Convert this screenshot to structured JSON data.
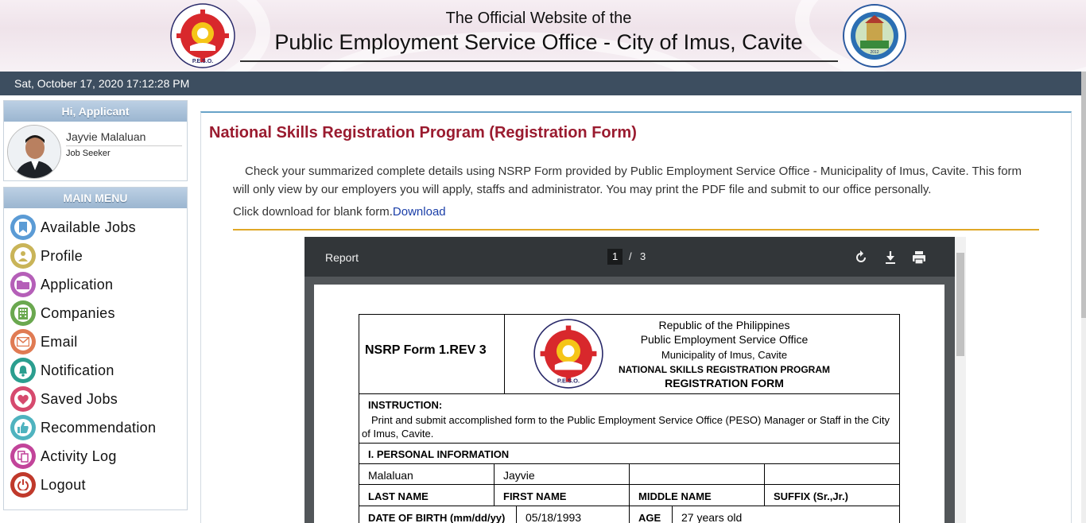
{
  "header": {
    "subtitle": "The Official Website of the",
    "title": "Public Employment Service Office - City of Imus, Cavite",
    "peso_logo_text": "PUBLIC EMPLOYMENT SERVICE OFFICE P.E.S.O.",
    "imus_logo_text": "LUNGSOD NG IMUS LALAWIGAN NG CAVITE 2012"
  },
  "datetime": "Sat, October 17, 2020 17:12:28 PM",
  "user_panel": {
    "heading": "Hi, Applicant",
    "name": "Jayvie Malaluan",
    "role": "Job Seeker"
  },
  "main_menu": {
    "heading": "MAIN MENU",
    "items": [
      {
        "label": "Available Jobs",
        "icon": "bookmark-icon",
        "color": "#5b9bd5"
      },
      {
        "label": "Profile",
        "icon": "user-icon",
        "color": "#c9b458"
      },
      {
        "label": "Application",
        "icon": "folder-icon",
        "color": "#b55fb8"
      },
      {
        "label": "Companies",
        "icon": "building-icon",
        "color": "#6aa84f"
      },
      {
        "label": "Email",
        "icon": "envelope-icon",
        "color": "#e07b53"
      },
      {
        "label": "Notification",
        "icon": "bell-icon",
        "color": "#2b9e8f"
      },
      {
        "label": "Saved Jobs",
        "icon": "heart-icon",
        "color": "#d64a6e"
      },
      {
        "label": "Recommendation",
        "icon": "thumbs-up-icon",
        "color": "#4fb3bf"
      },
      {
        "label": "Activity Log",
        "icon": "copy-icon",
        "color": "#c2449a"
      },
      {
        "label": "Logout",
        "icon": "power-icon",
        "color": "#c0392b"
      }
    ]
  },
  "content": {
    "title": "National Skills Registration Program (Registration Form)",
    "description": "Check your summarized complete details using NSRP Form provided by Public Employment Service Office - Municipality of Imus, Cavite. This form will only view by our employers you will apply, staffs and administrator. You may print the PDF file and submit to our office personally.",
    "download_prefix": "Click download for blank form.",
    "download_link": "Download"
  },
  "pdf_viewer": {
    "title": "Report",
    "current_page": "1",
    "separator": "/",
    "total_pages": "3",
    "toolbar_icons": [
      "rotate-icon",
      "download-icon",
      "print-icon"
    ]
  },
  "form": {
    "form_code": "NSRP Form 1.REV 3",
    "agency_line1": "Republic of the Philippines",
    "agency_line2": "Public Employment Service Office",
    "agency_line3": "Municipality of Imus, Cavite",
    "program": "NATIONAL SKILLS REGISTRATION PROGRAM",
    "form_title": "REGISTRATION FORM",
    "instruction_heading": "INSTRUCTION:",
    "instruction_text": "Print and submit accomplished form to the Public Employment Service Office (PESO) Manager or Staff in the City of Imus, Cavite.",
    "section1": "I. PERSONAL INFORMATION",
    "last_name_value": "Malaluan",
    "first_name_value": "Jayvie",
    "middle_name_value": "",
    "suffix_value": "",
    "last_name_label": "LAST NAME",
    "first_name_label": "FIRST NAME",
    "middle_name_label": "MIDDLE NAME",
    "suffix_label": "SUFFIX (Sr.,Jr.)",
    "dob_label": "DATE OF BIRTH (mm/dd/yy)",
    "dob_value": "05/18/1993",
    "age_label": "AGE",
    "age_value": "27 years old"
  }
}
